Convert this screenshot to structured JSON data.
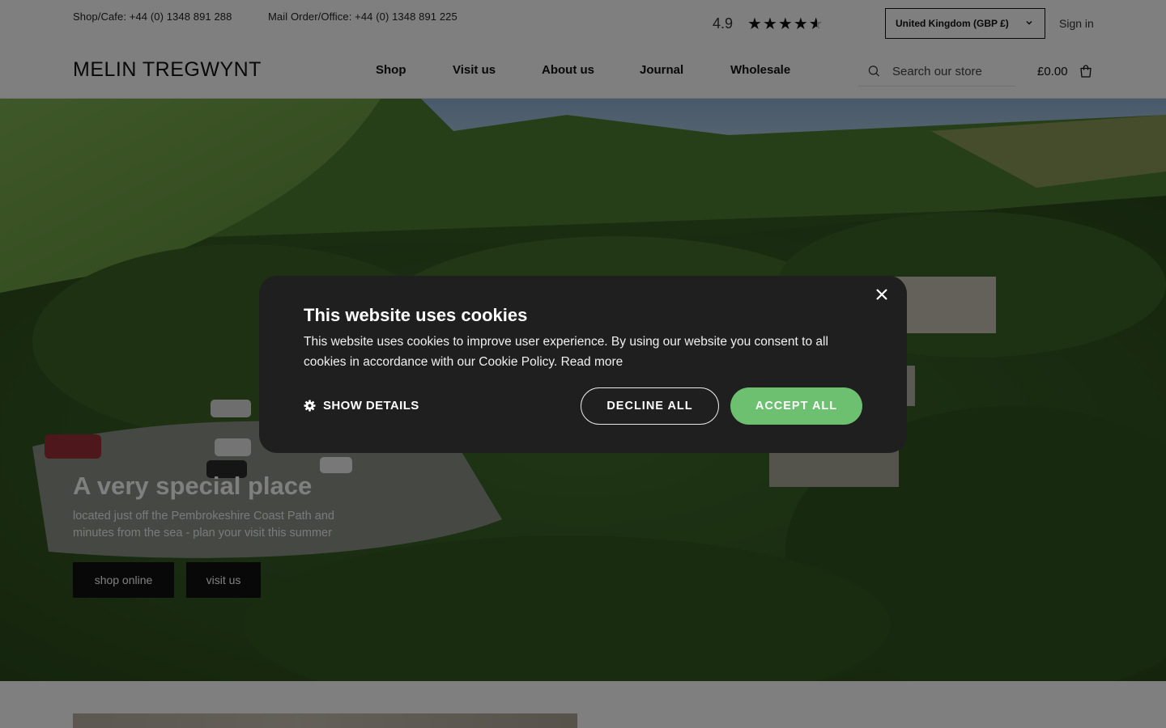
{
  "topbar": {
    "shop_phone": "Shop/Cafe: +44 (0) 1348 891 288",
    "office_phone": "Mail Order/Office: +44 (0) 1348 891 225",
    "rating_value": "4.9",
    "rating_stars": 4.5,
    "country": "United Kingdom (GBP £)",
    "sign_in": "Sign in"
  },
  "header": {
    "logo": "MELIN TREGWYNT",
    "nav": [
      "Shop",
      "Visit us",
      "About us",
      "Journal",
      "Wholesale"
    ],
    "search_placeholder": "Search our store",
    "cart_total": "£0.00",
    "icons": [
      "search-icon",
      "cart-icon",
      "chevron-down-icon",
      "star-icon"
    ]
  },
  "hero": {
    "title": "A very special place",
    "subtitle": "located just off the Pembrokeshire Coast Path and minutes from the sea - plan your visit this summer",
    "buttons": [
      "shop online",
      "visit us"
    ]
  },
  "cookie_modal": {
    "title": "This website uses cookies",
    "text": "This website uses cookies to improve user experience. By using our website you consent to all cookies in accordance with our Cookie Policy. Read more",
    "show_details": "SHOW DETAILS",
    "decline": "DECLINE ALL",
    "accept": "ACCEPT ALL",
    "icons": [
      "close-icon",
      "gear-icon"
    ]
  },
  "colors": {
    "accept_green": "#6cc070",
    "modal_bg": "#1f1f1f",
    "overlay": "rgba(0,0,0,0.5)",
    "button_dark": "#111111"
  }
}
